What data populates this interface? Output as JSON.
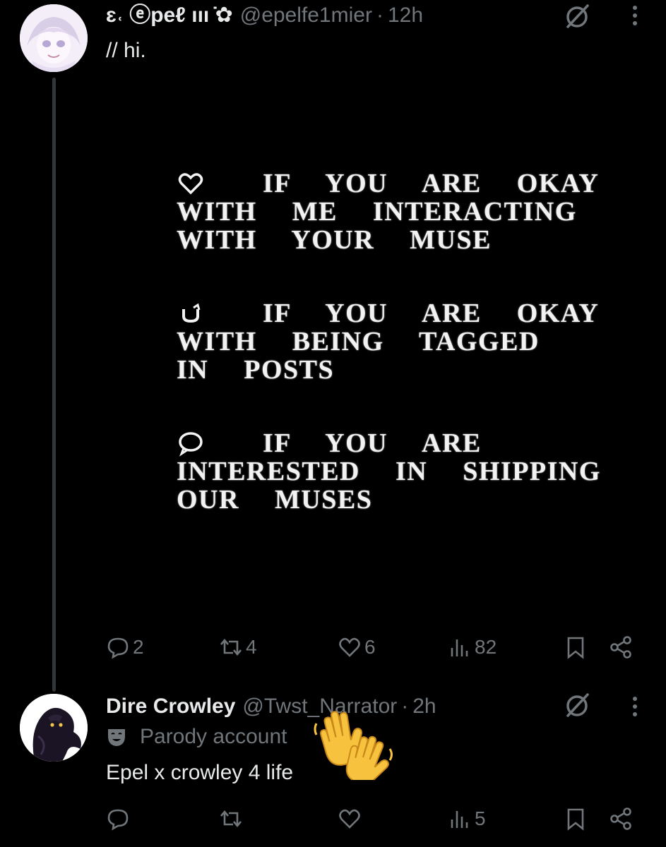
{
  "post1": {
    "display_name": "ɛ˓ ⓔpeℓ ııı ̇✿",
    "handle": "@epelfe1mier",
    "separator": "·",
    "time": "12h",
    "text": "// hi.",
    "media_lines": {
      "block1": [
        "IF  YOU  ARE  OKAY",
        "WITH  ME  INTERACTING",
        "WITH  YOUR  MUSE"
      ],
      "block2": [
        "IF  YOU  ARE  OKAY",
        "WITH  BEING  TAGGED",
        "IN  POSTS"
      ],
      "block3": [
        "IF  YOU  ARE",
        "INTERESTED  IN  SHIPPING",
        "OUR  MUSES"
      ]
    },
    "media_icons": [
      "heart-icon",
      "repost-icon",
      "speech-bubble-icon"
    ],
    "actions": {
      "replies": "2",
      "reposts": "4",
      "likes": "6",
      "views": "82"
    }
  },
  "post2": {
    "display_name": "Dire Crowley",
    "handle": "@Twst_Narrator",
    "separator": "·",
    "time": "2h",
    "label": "Parody account",
    "text": "Epel x crowley 4 life",
    "emoji": "waving-hands",
    "actions": {
      "replies": "",
      "reposts": "",
      "likes": "",
      "views": "5"
    }
  },
  "colors": {
    "background": "#000000",
    "primary_text": "#e7e9ea",
    "secondary_text": "#71767b",
    "thread_line": "#333639"
  }
}
